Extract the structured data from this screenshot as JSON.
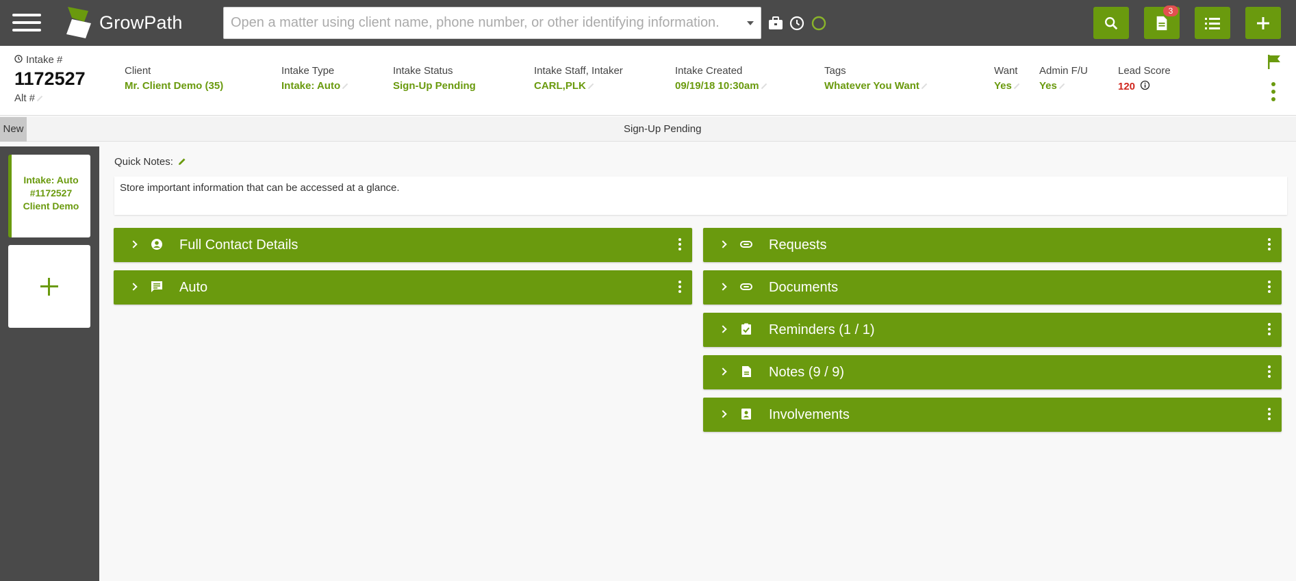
{
  "app": {
    "name": "GrowPath",
    "brand_color": "#6a9a0e",
    "topbar_color": "#4a4a4a"
  },
  "search": {
    "placeholder": "Open a matter using client name, phone number, or other identifying information."
  },
  "topbar": {
    "icons": [
      "briefcase-icon",
      "clock-icon",
      "status-ring-icon"
    ],
    "buttons": [
      {
        "name": "search-button",
        "icon": "search-icon"
      },
      {
        "name": "documents-button",
        "icon": "document-icon",
        "badge": "3"
      },
      {
        "name": "list-button",
        "icon": "list-icon"
      },
      {
        "name": "add-button",
        "icon": "plus-icon"
      }
    ]
  },
  "header": {
    "intake_label": "Intake #",
    "intake_number": "1172527",
    "alt_label": "Alt #",
    "fields": [
      {
        "label": "Client",
        "value": "Mr. Client Demo (35)"
      },
      {
        "label": "Intake Type",
        "value": "Intake: Auto"
      },
      {
        "label": "Intake Status",
        "value": "Sign-Up Pending"
      },
      {
        "label": "Intake Staff, Intaker",
        "value": "CARL,PLK"
      },
      {
        "label": "Intake Created",
        "value": "09/19/18 10:30am"
      },
      {
        "label": "Tags",
        "value": "Whatever You Want"
      },
      {
        "label": "Want",
        "value": "Yes"
      },
      {
        "label": "Admin F/U",
        "value": "Yes"
      },
      {
        "label": "Lead Score",
        "value": "120"
      }
    ]
  },
  "status_bar": {
    "stage": "New",
    "status": "Sign-Up Pending"
  },
  "sidebar": {
    "card_lines": [
      "Intake: Auto",
      "#1172527",
      "Client Demo"
    ]
  },
  "quick_notes": {
    "label": "Quick Notes:",
    "text": "Store important information that can be accessed at a glance."
  },
  "panels_left": [
    {
      "title": "Full Contact Details",
      "icon": "user-circle-icon"
    },
    {
      "title": "Auto",
      "icon": "message-icon"
    }
  ],
  "panels_right": [
    {
      "title": "Requests",
      "icon": "paperclip-icon"
    },
    {
      "title": "Documents",
      "icon": "paperclip-icon"
    },
    {
      "title": "Reminders (1 / 1)",
      "icon": "checklist-icon"
    },
    {
      "title": "Notes (9 / 9)",
      "icon": "note-icon"
    },
    {
      "title": "Involvements",
      "icon": "contact-card-icon"
    }
  ]
}
